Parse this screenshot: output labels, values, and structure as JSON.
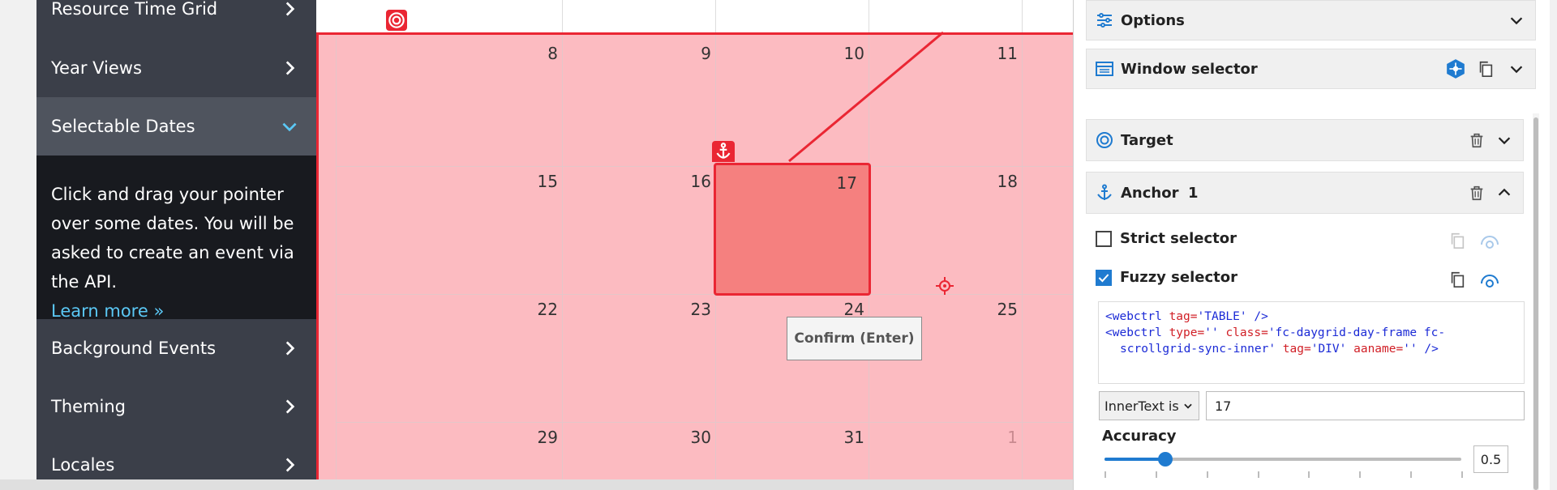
{
  "sidebar": {
    "items": [
      {
        "label": "Resource Time Grid"
      },
      {
        "label": "Year Views"
      },
      {
        "label": "Selectable Dates"
      },
      {
        "label": "Background Events"
      },
      {
        "label": "Theming"
      },
      {
        "label": "Locales"
      }
    ],
    "description": "Click and drag your pointer over some dates. You will be asked to create an event via the API.",
    "learn_more": "Learn more »"
  },
  "calendar": {
    "weeks": [
      [
        "8",
        "9",
        "10",
        "11"
      ],
      [
        "15",
        "16",
        "17",
        "18"
      ],
      [
        "22",
        "23",
        "24",
        "25"
      ],
      [
        "29",
        "30",
        "31",
        "1"
      ]
    ],
    "confirm_button": "Confirm (Enter)"
  },
  "panel": {
    "options_label": "Options",
    "window_selector_label": "Window selector",
    "target_label": "Target",
    "anchor_label": "Anchor",
    "anchor_count": "1",
    "strict_selector_label": "Strict selector",
    "strict_checked": false,
    "fuzzy_selector_label": "Fuzzy selector",
    "fuzzy_checked": true,
    "code": {
      "line1_open": "<webctrl",
      "line1_attr": "tag=",
      "line1_val": "'TABLE'",
      "line1_close": "/>",
      "line2_open": "<webctrl",
      "line2_attr1": "type=",
      "line2_val1": "''",
      "line2_attr2": "class=",
      "line2_val2": "'fc-daygrid-day-frame fc-",
      "line3_val2": "scrollgrid-sync-inner'",
      "line3_attr3": "tag=",
      "line3_val3": "'DIV'",
      "line3_attr4": "aaname=",
      "line3_val4": "''",
      "line3_close": "/>"
    },
    "innertext_select": "InnerText is",
    "innertext_value": "17",
    "accuracy_label": "Accuracy",
    "accuracy_value": "0.5",
    "accuracy_fraction": 0.17
  },
  "colors": {
    "selection_red": "#ea2633",
    "accent_blue": "#1f7bd0",
    "link_blue": "#5bc8f5",
    "sidebar_bg": "#3b3f49"
  }
}
